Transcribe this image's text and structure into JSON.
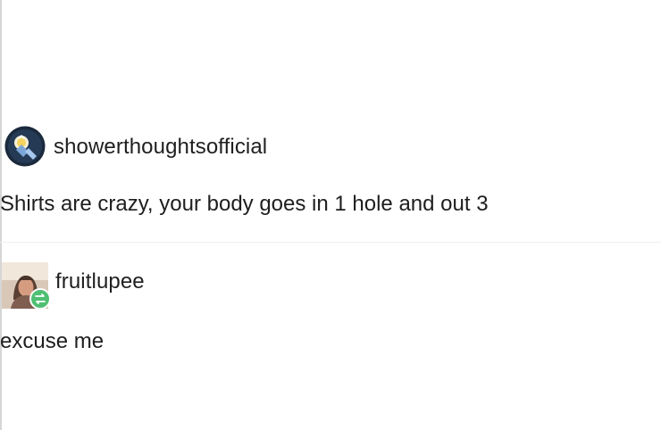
{
  "original_post": {
    "username": "showerthoughtsofficial",
    "text": "Shirts are crazy, your body goes in 1 hole and out 3",
    "avatar_icon": "lightbulb-avatar-icon"
  },
  "reblog": {
    "username": "fruitlupee",
    "text": "excuse me",
    "avatar_icon": "profile-photo-avatar",
    "badge_icon": "reblog-icon",
    "badge_color": "#4fbf73"
  },
  "colors": {
    "background": "#ffffff",
    "text": "#1f1f1f",
    "divider": "#eeeeee"
  }
}
